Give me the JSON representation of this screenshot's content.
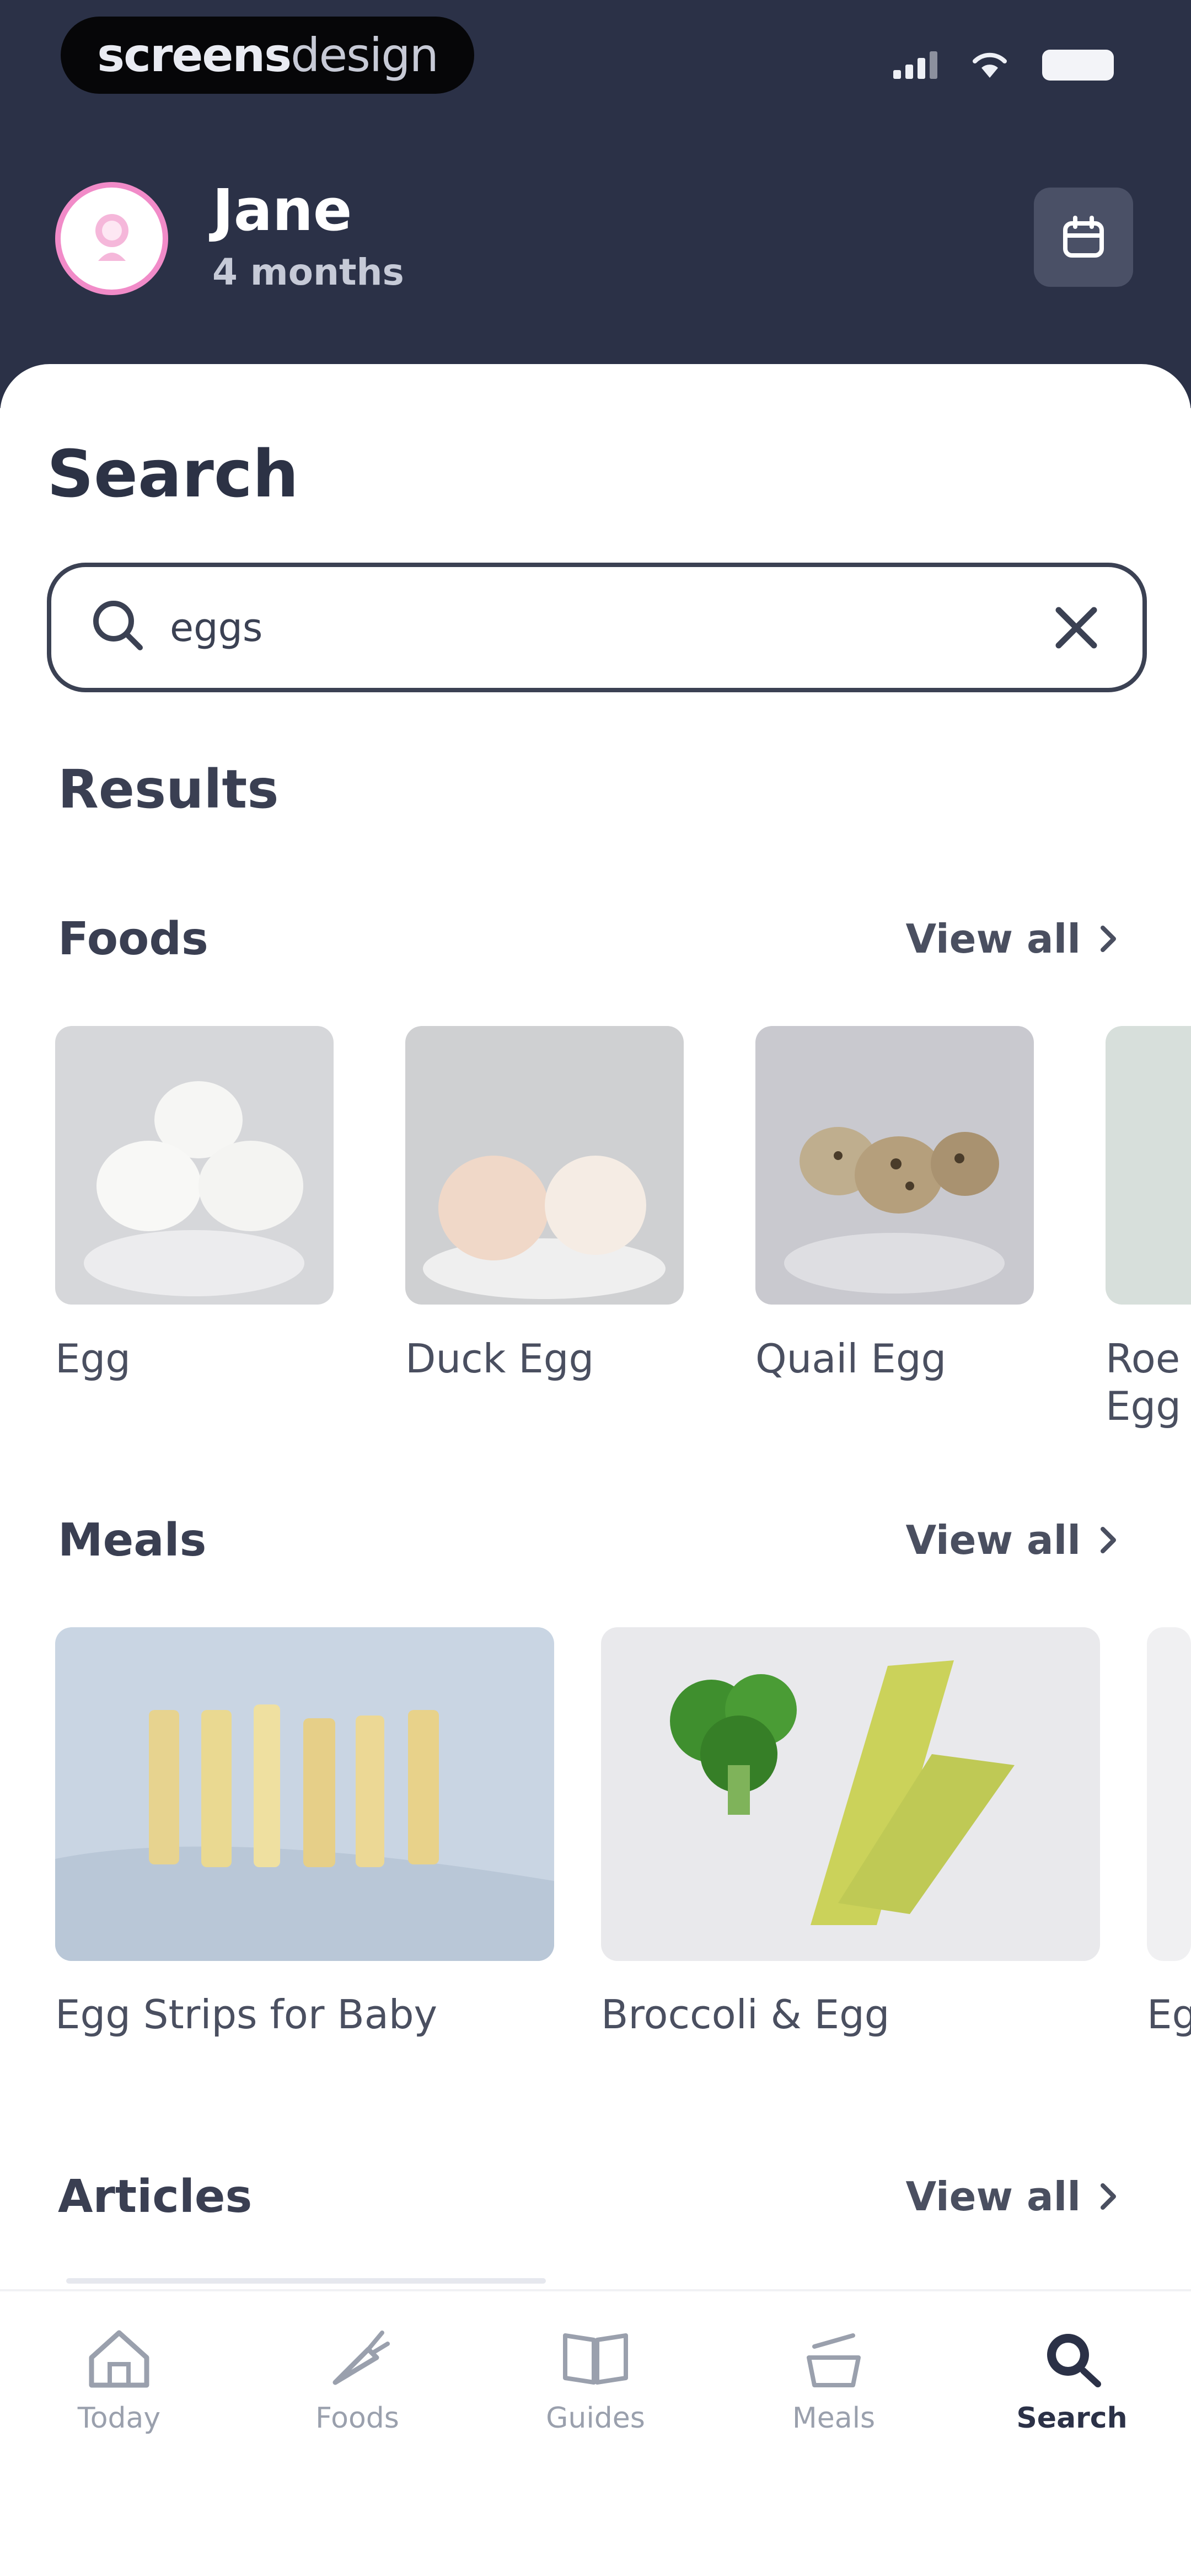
{
  "status_bar": {
    "brand_prefix": "screens",
    "brand_suffix": "design"
  },
  "profile": {
    "name": "Jane",
    "age": "4 months"
  },
  "search": {
    "title": "Search",
    "query": "eggs"
  },
  "results": {
    "title": "Results",
    "foods": {
      "title": "Foods",
      "view_all": "View all",
      "items": [
        {
          "label": "Egg"
        },
        {
          "label": "Duck Egg"
        },
        {
          "label": "Quail Egg"
        },
        {
          "label": "Roe Egg"
        }
      ]
    },
    "meals": {
      "title": "Meals",
      "view_all": "View all",
      "items": [
        {
          "label": "Egg Strips for Baby"
        },
        {
          "label": "Broccoli & Egg"
        },
        {
          "label": "Eg"
        }
      ]
    },
    "articles": {
      "title": "Articles",
      "view_all": "View all"
    }
  },
  "nav": {
    "items": [
      {
        "label": "Today",
        "icon": "home-icon"
      },
      {
        "label": "Foods",
        "icon": "carrot-icon"
      },
      {
        "label": "Guides",
        "icon": "book-icon"
      },
      {
        "label": "Meals",
        "icon": "bowl-icon"
      },
      {
        "label": "Search",
        "icon": "search-icon"
      }
    ],
    "active": "Search"
  },
  "colors": {
    "header_bg": "#2b3147",
    "accent_pink": "#f18bc8",
    "text_dark": "#3a3f52",
    "text_muted": "#9aa0ad"
  }
}
